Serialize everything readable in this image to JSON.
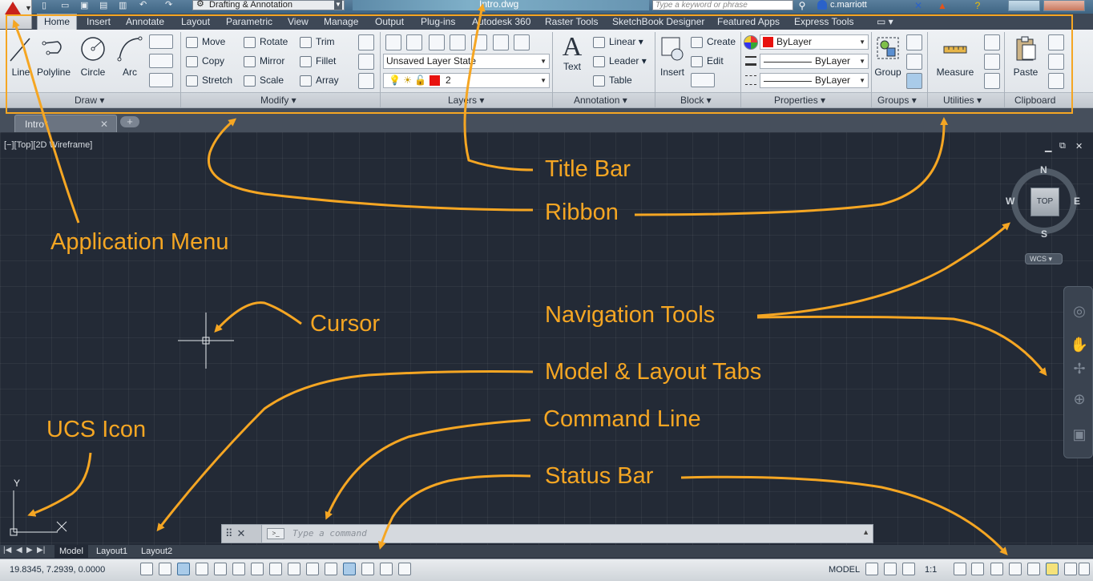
{
  "title_bar": {
    "workspace": "Drafting & Annotation",
    "document_title": "Intro.dwg",
    "search_placeholder": "Type a keyword or phrase",
    "user": "c.marriott"
  },
  "ribbon": {
    "tabs": [
      "Home",
      "Insert",
      "Annotate",
      "Layout",
      "Parametric",
      "View",
      "Manage",
      "Output",
      "Plug-ins",
      "Autodesk 360",
      "Raster Tools",
      "SketchBook Designer",
      "Featured Apps",
      "Express Tools"
    ],
    "active_tab": "Home",
    "panels": {
      "draw": {
        "title": "Draw",
        "line": "Line",
        "polyline": "Polyline",
        "circle": "Circle",
        "arc": "Arc"
      },
      "modify": {
        "title": "Modify",
        "move": "Move",
        "rotate": "Rotate",
        "trim": "Trim",
        "copy": "Copy",
        "mirror": "Mirror",
        "fillet": "Fillet",
        "stretch": "Stretch",
        "scale": "Scale",
        "array": "Array"
      },
      "layers": {
        "title": "Layers",
        "layer_state": "Unsaved Layer State",
        "current_layer": "2",
        "layer_color": "#e8120f"
      },
      "annotation": {
        "title": "Annotation",
        "text": "Text",
        "linear": "Linear",
        "leader": "Leader",
        "table": "Table"
      },
      "block": {
        "title": "Block",
        "insert": "Insert",
        "create": "Create",
        "edit": "Edit"
      },
      "properties": {
        "title": "Properties",
        "color": "ByLayer",
        "linetype": "ByLayer",
        "lineweight": "ByLayer",
        "color_swatch": "#e8120f"
      },
      "groups": {
        "title": "Groups",
        "group": "Group"
      },
      "utilities": {
        "title": "Utilities",
        "measure": "Measure"
      },
      "clipboard": {
        "title": "Clipboard",
        "paste": "Paste"
      }
    }
  },
  "file_tabs": {
    "current": "Intro*"
  },
  "viewport": {
    "label": "[−][Top][2D Wireframe]"
  },
  "viewcube": {
    "n": "N",
    "s": "S",
    "e": "E",
    "w": "W",
    "face": "TOP",
    "ucs": "WCS"
  },
  "ucs_icon": {
    "y": "Y",
    "x": "X"
  },
  "annotations": {
    "title_bar": "Title Bar",
    "ribbon": "Ribbon",
    "application_menu": "Application Menu",
    "cursor": "Cursor",
    "navigation_tools": "Navigation Tools",
    "model_layout_tabs": "Model & Layout Tabs",
    "command_line": "Command Line",
    "ucs_icon": "UCS Icon",
    "status_bar": "Status Bar"
  },
  "command_line": {
    "placeholder": "Type a command"
  },
  "layout_tabs": [
    "Model",
    "Layout1",
    "Layout2"
  ],
  "status_bar": {
    "coordinates": "19.8345, 7.2939, 0.0000",
    "space": "MODEL",
    "annotation_scale": "1:1"
  },
  "colors": {
    "annotation": "#f5a623",
    "canvas": "#232a36"
  }
}
